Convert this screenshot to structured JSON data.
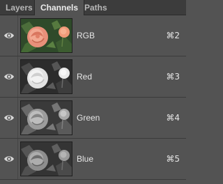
{
  "tabs": [
    {
      "label": "Layers"
    },
    {
      "label": "Channels"
    },
    {
      "label": "Paths"
    }
  ],
  "active_tab": "Channels",
  "channels": [
    {
      "name": "RGB",
      "shortcut": "⌘2",
      "mode": "color",
      "visible": true
    },
    {
      "name": "Red",
      "shortcut": "⌘3",
      "mode": "grayscale",
      "visible": true
    },
    {
      "name": "Green",
      "shortcut": "⌘4",
      "mode": "grayscale",
      "visible": true
    },
    {
      "name": "Blue",
      "shortcut": "⌘5",
      "mode": "grayscale",
      "visible": true
    }
  ],
  "icons": {
    "visibility": "eye-icon"
  },
  "colors": {
    "panel_bg": "#535353",
    "tabbar_bg": "#3c3c3c",
    "text": "#e6e6e6"
  }
}
